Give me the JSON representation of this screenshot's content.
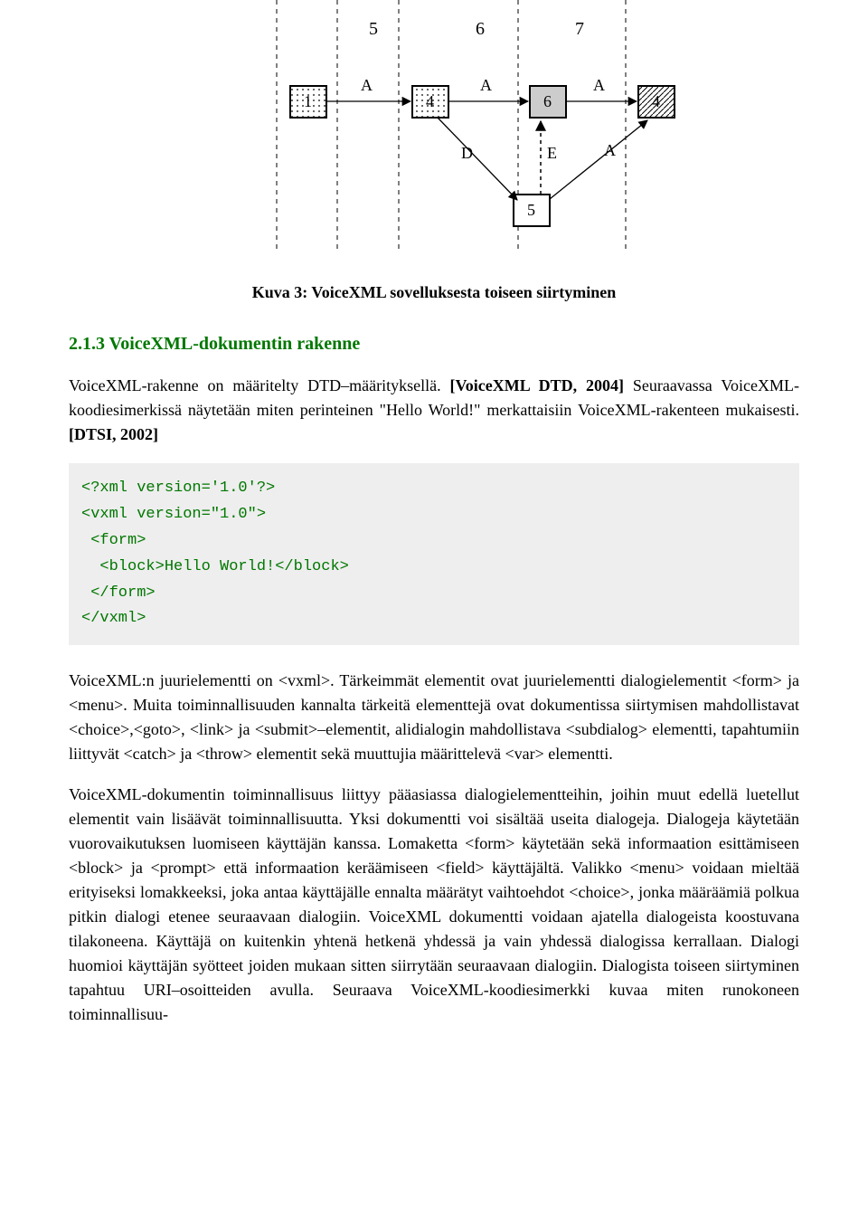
{
  "diagram": {
    "top_labels": [
      "5",
      "6",
      "7"
    ],
    "boxes": [
      "1",
      "4",
      "6",
      "4",
      "5"
    ],
    "edge_labels": [
      "A",
      "A",
      "A",
      "D",
      "E",
      "A"
    ]
  },
  "caption": "Kuva 3: VoiceXML sovelluksesta toiseen siirtyminen",
  "heading": "2.1.3 VoiceXML-dokumentin rakenne",
  "para1_a": "VoiceXML-rakenne on määritelty DTD–määrityksellä. ",
  "para1_ref1": "[VoiceXML DTD, 2004]",
  "para1_b": " Seuraavassa VoiceXML-koodiesimerkissä näytetään miten perinteinen \"Hello World!\" merkattaisiin VoiceXML-rakenteen mukaisesti. ",
  "para1_ref2": "[DTSI, 2002]",
  "code": "<?xml version='1.0'?>\n<vxml version=\"1.0\">\n <form>\n  <block>Hello World!</block>\n </form>\n</vxml>",
  "para2": "VoiceXML:n juurielementti on <vxml>. Tärkeimmät elementit ovat juurielementti dialogielementit <form> ja <menu>. Muita toiminnallisuuden kannalta tärkeitä elementtejä ovat dokumentissa siirtymisen mahdollistavat <choice>,<goto>, <link> ja <submit>–elementit, alidialogin mahdollistava <subdialog> elementti, tapahtumiin liittyvät <catch> ja <throw> elementit sekä muuttujia määrittelevä <var> elementti.",
  "para3": "VoiceXML-dokumentin toiminnallisuus liittyy pääasiassa dialogielementteihin, joihin muut edellä luetellut elementit vain lisäävät toiminnallisuutta. Yksi dokumentti voi sisältää useita dialogeja. Dialogeja käytetään vuorovaikutuksen luomiseen käyttäjän kanssa. Lomaketta <form> käytetään sekä informaation esittämiseen <block> ja <prompt> että informaation keräämiseen <field> käyttäjältä. Valikko <menu> voidaan mieltää erityiseksi lomakkeeksi, joka antaa käyttäjälle ennalta määrätyt vaihtoehdot <choice>, jonka määräämiä polkua pitkin dialogi etenee seuraavaan dialogiin. VoiceXML dokumentti voidaan ajatella dialogeista koostuvana tilakoneena. Käyttäjä on kuitenkin yhtenä hetkenä yhdessä ja vain yhdessä dialogissa kerrallaan. Dialogi huomioi käyttäjän syötteet joiden mukaan sitten siirrytään seuraavaan dialogiin. Dialogista toiseen siirtyminen tapahtuu URI–osoitteiden avulla. Seuraava VoiceXML-koodiesimerkki kuvaa miten runokoneen toiminnallisuu-"
}
